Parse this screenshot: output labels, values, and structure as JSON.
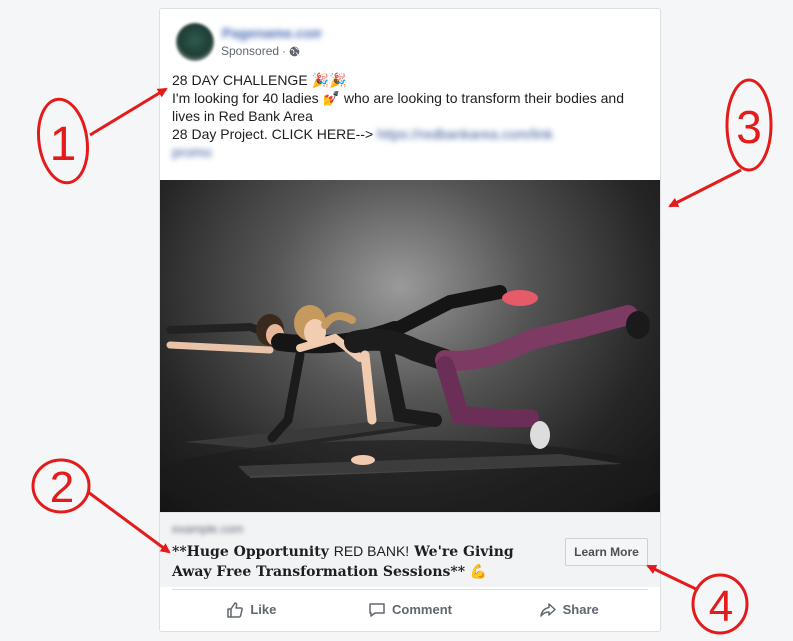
{
  "post": {
    "sponsored_label": "Sponsored",
    "separator": "·",
    "text_line1": "28 DAY CHALLENGE 🎉🎉",
    "text_line2": "I'm looking for 40 ladies 💅 who are looking to transform their bodies and",
    "text_line3": "lives in Red Bank Area",
    "text_line4": "28 Day Project. CLICK HERE-->",
    "cta_headline_a": "**Huge Opportunity ",
    "cta_headline_b": "RED BANK!",
    "cta_headline_c": " We're Giving Away Free Transformation Sessions** 💪",
    "learn_more_label": "Learn More"
  },
  "actions": {
    "like_label": "Like",
    "comment_label": "Comment",
    "share_label": "Share"
  },
  "annotations": {
    "n1": "1",
    "n2": "2",
    "n3": "3",
    "n4": "4"
  },
  "colors": {
    "annotation_red": "#e41b1b",
    "link_blue": "#385898"
  },
  "icons": [
    "globe-icon",
    "like-icon",
    "comment-icon",
    "share-icon"
  ]
}
